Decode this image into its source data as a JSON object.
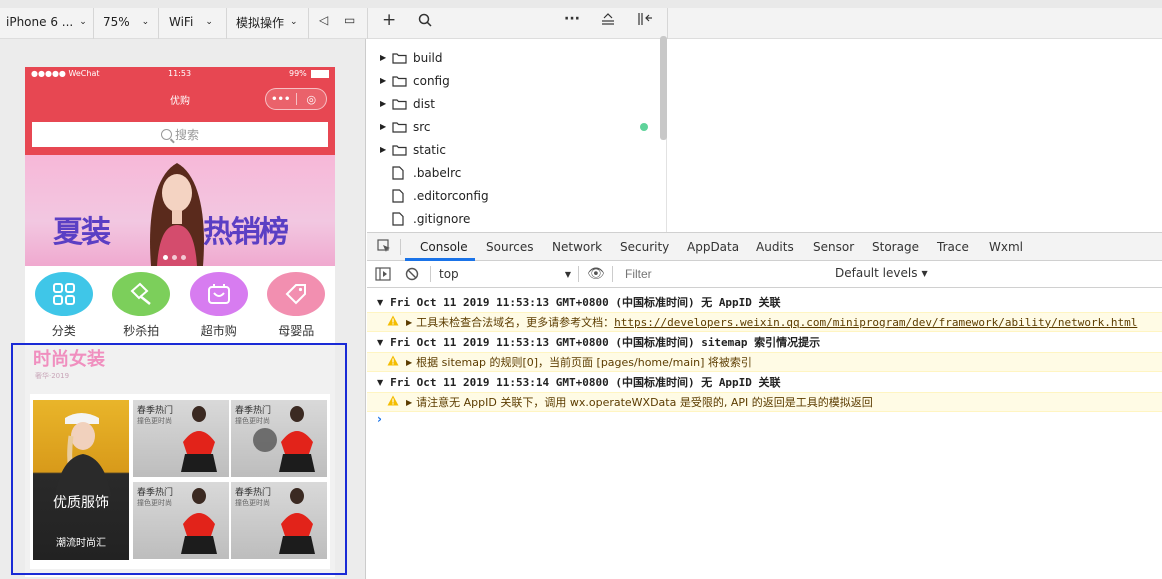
{
  "toolbar": {
    "device": "iPhone 6 ...",
    "zoom": "75%",
    "network": "WiFi",
    "simulate": "模拟操作"
  },
  "phone": {
    "carrier": "●●●●● WeChat",
    "time": "11:53",
    "battery": "99%",
    "title": "优购",
    "search_placeholder": "搜索",
    "banner_left": "夏装",
    "banner_right": "热销榜",
    "categories": [
      {
        "label": "分类",
        "color": "#3fc6e8"
      },
      {
        "label": "秒杀拍",
        "color": "#7ccf5b"
      },
      {
        "label": "超市购",
        "color": "#d77cf0"
      },
      {
        "label": "母婴品",
        "color": "#f28fb0"
      }
    ],
    "floor": {
      "title": "时尚女装",
      "subtitle": "奢华·2019",
      "big_title": "优质服饰",
      "big_sub": "潮流时尚汇",
      "cell_title": "春季热门",
      "cell_sub": "撞色更时尚"
    }
  },
  "file_tree": [
    {
      "name": "build",
      "type": "folder"
    },
    {
      "name": "config",
      "type": "folder"
    },
    {
      "name": "dist",
      "type": "folder"
    },
    {
      "name": "src",
      "type": "folder"
    },
    {
      "name": "static",
      "type": "folder"
    },
    {
      "name": ".babelrc",
      "type": "file"
    },
    {
      "name": ".editorconfig",
      "type": "file"
    },
    {
      "name": ".gitignore",
      "type": "file"
    }
  ],
  "devtools": {
    "tabs": [
      "Console",
      "Sources",
      "Network",
      "Security",
      "AppData",
      "Audits",
      "Sensor",
      "Storage",
      "Trace",
      "Wxml"
    ],
    "context": "top",
    "filter_placeholder": "Filter",
    "levels": "Default levels",
    "messages": [
      {
        "group": "Fri Oct 11 2019 11:53:13 GMT+0800 (中国标准时间) 无 AppID 关联",
        "warn_pre": "工具未检查合法域名，更多请参考文档：",
        "warn_link": "https://developers.weixin.qq.com/miniprogram/dev/framework/ability/network.html"
      },
      {
        "group": "Fri Oct 11 2019 11:53:13 GMT+0800 (中国标准时间) sitemap 索引情况提示",
        "warn_pre": " 根据 sitemap 的规则[0]，当前页面 [pages/home/main] 将被索引",
        "warn_link": ""
      },
      {
        "group": "Fri Oct 11 2019 11:53:14 GMT+0800 (中国标准时间) 无 AppID 关联",
        "warn_pre": "请注意无 AppID 关联下，调用 wx.operateWXData 是受限的, API 的返回是工具的模拟返回",
        "warn_link": ""
      }
    ],
    "prompt": "›"
  }
}
